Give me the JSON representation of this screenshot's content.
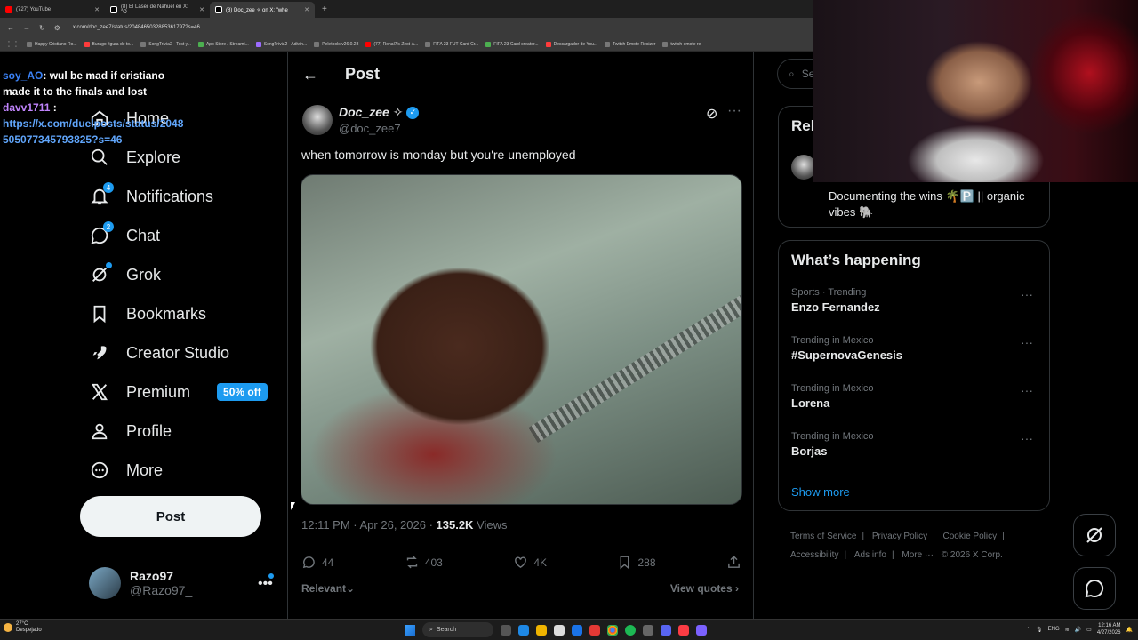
{
  "browser": {
    "tabs": [
      {
        "label": "(727) YouTube",
        "color": "#ff0000"
      },
      {
        "label": "(8) El Láser de Nahuel en X: \"O",
        "color": "#ffffff"
      },
      {
        "label": "(8) Doc_zee ✧ on X: \"whe",
        "color": "#ffffff"
      }
    ],
    "url": "x.com/doc_zee7/status/2048465032885361797?s=46",
    "bookmarks": [
      "Happy Cristiano Ro...",
      "Burago figura de to...",
      "SongTrivia2 - Test y...",
      "App Store / Streami...",
      "SongTrivia2 - Adivin...",
      "Peletools v26.0.28",
      "(77) Ronal7's Zest-A...",
      "FIFA 23 FUT Card Cr...",
      "FIFA 23 Card creator...",
      "Descargador de You...",
      "Twitch Emote Resizer",
      "twitch emote re"
    ]
  },
  "chat": {
    "user1": "soy_AO",
    "msg1": ": wul be mad if cristiano made it to the finals and lost",
    "user2": "davv1711",
    "msg2_sep": ":",
    "msg2_link": "https://x.com/duelposts/status/2048505077345793825?s=46"
  },
  "nav": {
    "home": "Home",
    "explore": "Explore",
    "notifications": "Notifications",
    "notifications_count": "4",
    "chat": "Chat",
    "chat_count": "2",
    "grok": "Grok",
    "bookmarks": "Bookmarks",
    "creator_studio": "Creator Studio",
    "premium": "Premium",
    "premium_promo": "50% off",
    "profile": "Profile",
    "more": "More",
    "post_button": "Post"
  },
  "account": {
    "name": "Razo97",
    "handle": "@Razo97_"
  },
  "post": {
    "header": "Post",
    "author_name": "Doc_zee ✧",
    "author_handle": "@doc_zee7",
    "text": "when tomorrow is monday but you're unemployed",
    "time": "12:11 PM · Apr 26, 2026 · ",
    "views_count": "135.2K",
    "views_label": " Views",
    "replies": "44",
    "reposts": "403",
    "likes": "4K",
    "bookmarks": "288",
    "relevant": "Relevant",
    "view_quotes": "View quotes"
  },
  "right": {
    "search_placeholder": "Se",
    "relevant_title": "Rel",
    "relevant_bio": "Documenting the wins 🌴🅿️ || organic vibes 🐘",
    "whats_happening": "What’s happening",
    "trends": [
      {
        "category": "Sports · Trending",
        "name": "Enzo Fernandez"
      },
      {
        "category": "Trending in Mexico",
        "name": "#SupernovaGenesis"
      },
      {
        "category": "Trending in Mexico",
        "name": "Lorena"
      },
      {
        "category": "Trending in Mexico",
        "name": "Borjas"
      }
    ],
    "show_more": "Show more",
    "footer": {
      "terms": "Terms of Service",
      "privacy": "Privacy Policy",
      "cookie": "Cookie Policy",
      "accessibility": "Accessibility",
      "ads": "Ads info",
      "more": "More ···",
      "copyright": "© 2026 X Corp."
    }
  },
  "taskbar": {
    "temp": "27°C",
    "weather": "Despejado",
    "search": "Search",
    "lang": "ENG",
    "time": "12:16 AM",
    "date": "4/27/2026"
  },
  "colors": {
    "accent": "#1d9bf0",
    "background": "#000000",
    "text": "#e7e9ea",
    "muted": "#71767b",
    "border": "#2f3336"
  }
}
